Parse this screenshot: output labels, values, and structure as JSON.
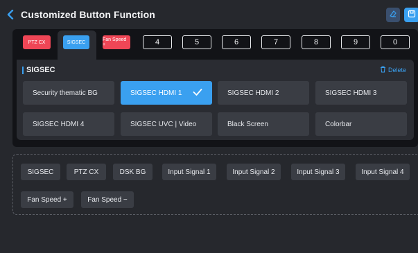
{
  "header": {
    "title": "Customized Button Function",
    "back_icon": "chevron-left-icon",
    "action_icons": [
      "eraser-icon",
      "save-icon"
    ]
  },
  "tabs": [
    {
      "label": "PTZ CX",
      "style": "red"
    },
    {
      "label": "SIGSEC",
      "style": "blue",
      "active": true
    },
    {
      "label": "Fan Speed +",
      "style": "red"
    },
    {
      "label": "4",
      "style": "num"
    },
    {
      "label": "5",
      "style": "num"
    },
    {
      "label": "6",
      "style": "num"
    },
    {
      "label": "7",
      "style": "num"
    },
    {
      "label": "8",
      "style": "num"
    },
    {
      "label": "9",
      "style": "num"
    },
    {
      "label": "0",
      "style": "num"
    }
  ],
  "section": {
    "title": "SIGSEC",
    "delete_label": "Delete",
    "options": [
      {
        "label": "Security thematic BG",
        "selected": false
      },
      {
        "label": "SIGSEC HDMI 1",
        "selected": true
      },
      {
        "label": "SIGSEC HDMI 2",
        "selected": false
      },
      {
        "label": "SIGSEC HDMI 3",
        "selected": false
      },
      {
        "label": "SIGSEC HDMI 4",
        "selected": false
      },
      {
        "label": "SIGSEC UVC | Video",
        "selected": false
      },
      {
        "label": "Black Screen",
        "selected": false
      },
      {
        "label": "Colorbar",
        "selected": false
      }
    ]
  },
  "palette": {
    "chips": [
      "SIGSEC",
      "PTZ CX",
      "DSK BG",
      "Input Signal 1",
      "Input Signal 2",
      "Input Signal 3",
      "Input Signal 4",
      "Fan Speed +",
      "Fan Speed −"
    ]
  },
  "colors": {
    "accent": "#3aa0f0",
    "danger": "#ef4656",
    "background": "#26282d",
    "panel": "#121317"
  }
}
